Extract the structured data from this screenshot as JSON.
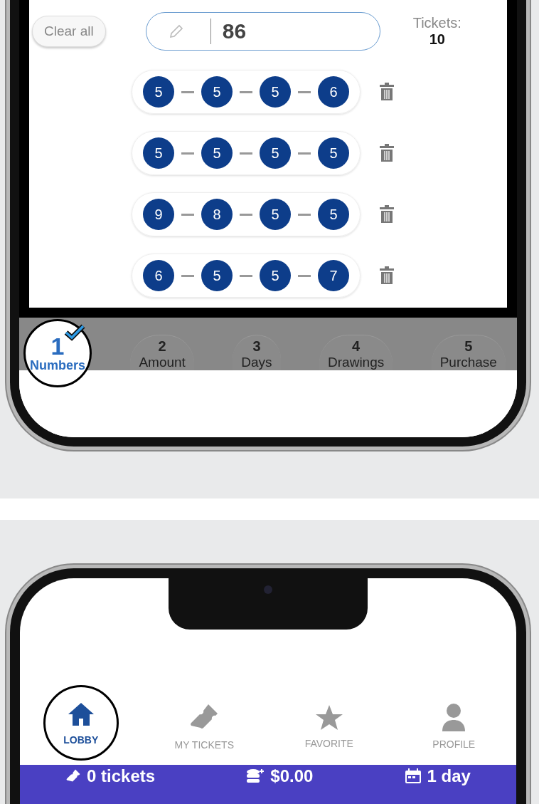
{
  "number_screen": {
    "clear_button": "Clear all",
    "amount_input": {
      "value": "86"
    },
    "tickets": {
      "label": "Tickets:",
      "count": "10"
    },
    "ticket_rows": [
      {
        "numbers": [
          "5",
          "5",
          "5",
          "6"
        ]
      },
      {
        "numbers": [
          "5",
          "5",
          "5",
          "5"
        ]
      },
      {
        "numbers": [
          "9",
          "8",
          "5",
          "5"
        ]
      },
      {
        "numbers": [
          "6",
          "5",
          "5",
          "7"
        ]
      }
    ],
    "steps": [
      {
        "number": "1",
        "label": "Numbers",
        "selected": true
      },
      {
        "number": "2",
        "label": "Amount",
        "selected": false
      },
      {
        "number": "3",
        "label": "Days",
        "selected": false
      },
      {
        "number": "4",
        "label": "Drawings",
        "selected": false
      },
      {
        "number": "5",
        "label": "Purchase",
        "selected": false
      }
    ]
  },
  "lobby_screen": {
    "nav_tabs": [
      {
        "kind": "home",
        "label": "LOBBY",
        "selected": true
      },
      {
        "kind": "ticket",
        "label": "MY TICKETS",
        "selected": false
      },
      {
        "kind": "star",
        "label": "FAVORITE",
        "selected": false
      },
      {
        "kind": "person",
        "label": "PROFILE",
        "selected": false
      }
    ],
    "summary_bar": [
      {
        "kind": "ticket",
        "text": "0 tickets"
      },
      {
        "kind": "coins",
        "text": "$0.00"
      },
      {
        "kind": "calendar",
        "text": "1 day"
      }
    ]
  }
}
